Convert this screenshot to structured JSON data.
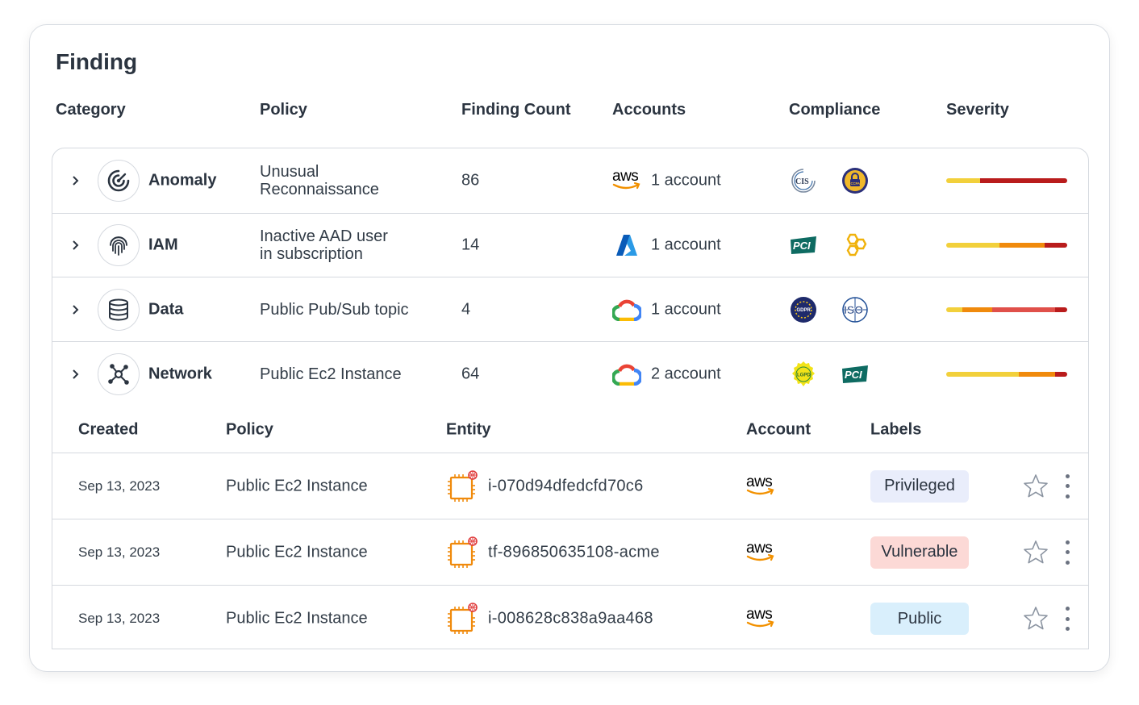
{
  "title": "Finding",
  "columns": {
    "category": "Category",
    "policy": "Policy",
    "finding_count": "Finding Count",
    "accounts": "Accounts",
    "compliance": "Compliance",
    "severity": "Severity"
  },
  "findings": [
    {
      "category": "Anomaly",
      "category_icon": "anomaly-target-icon",
      "policy_line1": "Unusual",
      "policy_line2": "Reconnaissance",
      "count": "86",
      "provider": "aws",
      "provider_label": "aws",
      "accounts": "1 account",
      "compliance": [
        "cis-badge",
        "ccpa-badge"
      ],
      "compliance_text": [
        "CIS",
        "CCPA"
      ],
      "severity": [
        {
          "color": "#f2d03b",
          "fraction": 0.28
        },
        {
          "color": "#b91c1c",
          "fraction": 0.72
        }
      ]
    },
    {
      "category": "IAM",
      "category_icon": "fingerprint-icon",
      "policy_line1": "Inactive AAD user",
      "policy_line2": "in subscription",
      "count": "14",
      "provider": "azure",
      "accounts": "1 account",
      "compliance": [
        "pci-badge",
        "honeycomb-badge"
      ],
      "compliance_text": [
        "PCI",
        ""
      ],
      "severity": [
        {
          "color": "#f2d03b",
          "fraction": 0.44
        },
        {
          "color": "#f08a0c",
          "fraction": 0.37
        },
        {
          "color": "#b91c1c",
          "fraction": 0.19
        }
      ]
    },
    {
      "category": "Data",
      "category_icon": "database-icon",
      "policy_line1": "Public Pub/Sub topic",
      "policy_line2": "",
      "count": "4",
      "provider": "gcp",
      "accounts": "1 account",
      "compliance": [
        "gdpr-badge",
        "iso-badge"
      ],
      "compliance_text": [
        "GDPR",
        "ISO"
      ],
      "severity": [
        {
          "color": "#f2d03b",
          "fraction": 0.13
        },
        {
          "color": "#f08a0c",
          "fraction": 0.25
        },
        {
          "color": "#e0504a",
          "fraction": 0.52
        },
        {
          "color": "#b91c1c",
          "fraction": 0.1
        }
      ]
    },
    {
      "category": "Network",
      "category_icon": "network-nodes-icon",
      "policy_line1": "Public Ec2 Instance",
      "policy_line2": "",
      "count": "64",
      "provider": "gcp",
      "accounts": "2 account",
      "compliance": [
        "lgpd-badge",
        "pci-badge"
      ],
      "compliance_text": [
        "LGPD",
        "PCI"
      ],
      "severity": [
        {
          "color": "#f2d03b",
          "fraction": 0.6
        },
        {
          "color": "#f08a0c",
          "fraction": 0.3
        },
        {
          "color": "#b91c1c",
          "fraction": 0.1
        }
      ]
    }
  ],
  "detail_columns": {
    "created": "Created",
    "policy": "Policy",
    "entity": "Entity",
    "account": "Account",
    "labels": "Labels"
  },
  "details": [
    {
      "created": "Sep 13, 2023",
      "policy": "Public Ec2 Instance",
      "entity": "i-070d94dfedcfd70c6",
      "account": "aws",
      "label": "Privileged",
      "label_bg": "#e9edfb",
      "label_color": "#2b3440"
    },
    {
      "created": "Sep 13, 2023",
      "policy": "Public Ec2 Instance",
      "entity": "tf-896850635108-acme",
      "account": "aws",
      "label": "Vulnerable",
      "label_bg": "#fcd9d6",
      "label_color": "#2b3440"
    },
    {
      "created": "Sep 13, 2023",
      "policy": "Public Ec2 Instance",
      "entity": "i-008628c838a9aa468",
      "account": "aws",
      "label": "Public",
      "label_bg": "#d9effc",
      "label_color": "#2b3440"
    }
  ],
  "colors": {
    "border": "#d5d9df",
    "text": "#333d48",
    "heading": "#2b3440",
    "aws_smile": "#f29100",
    "ec2_orange": "#f08a0c"
  }
}
